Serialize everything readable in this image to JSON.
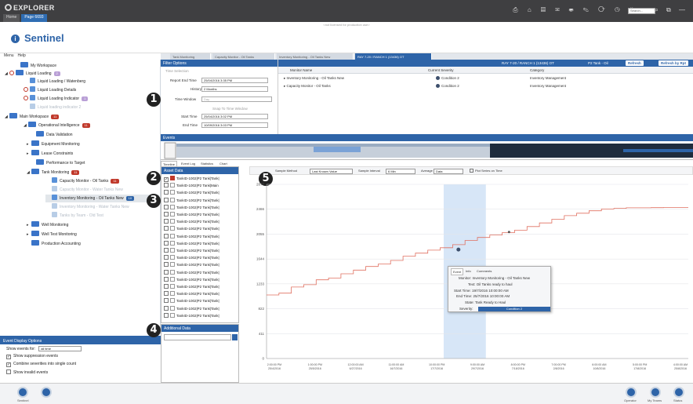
{
  "titlebar": {
    "app_title": "EXPLORER",
    "tabs": [
      "Home",
      "Page 6693"
    ],
    "search_placeholder": "Search..."
  },
  "header": {
    "app_name": "Sentinel",
    "message": "<not licensed for production use>"
  },
  "menu": {
    "items": [
      "Menu",
      "Help"
    ]
  },
  "tree": {
    "nodes": [
      {
        "label": "My Workspace"
      },
      {
        "label": "Liquid Loading",
        "badge": "2"
      },
      {
        "label": "Liquid Loading / Watenberg"
      },
      {
        "label": "Liquid Loading Details"
      },
      {
        "label": "Liquid Loading Indicator",
        "badge": "1"
      },
      {
        "label": "Liquid loading indicator 2"
      },
      {
        "label": "Main Workspace",
        "badge": "11"
      },
      {
        "label": "Operational Intelligence",
        "badge": "11"
      },
      {
        "label": "Data Validation"
      },
      {
        "label": "Equipment Monitoring"
      },
      {
        "label": "Lease Constraints"
      },
      {
        "label": "Performance to Target"
      },
      {
        "label": "Tank Monitoring",
        "badge": "11"
      },
      {
        "label": "Capacity Monitor - Oil Tanks",
        "badge": "11"
      },
      {
        "label": "Capacity Monitor - Water Tanks New"
      },
      {
        "label": "Inventory Monitoring - Oil Tanks New",
        "badge": "10"
      },
      {
        "label": "Inventory Monitoring - Water Tanks New"
      },
      {
        "label": "Tanks by Team - Old Test"
      },
      {
        "label": "Well Monitoring"
      },
      {
        "label": "Well Test Monitoring"
      },
      {
        "label": "Production Accounting"
      }
    ]
  },
  "event_display": {
    "title": "Event Display Options",
    "show_for_label": "Show events for:",
    "show_for_value": "all time",
    "opt1": "Show suppression events",
    "opt2": "Combine severities into single count",
    "opt3": "Show invalid events"
  },
  "footer": {
    "left_label": "Sentinel",
    "right_labels": [
      "Operator",
      "My Teams",
      "Status"
    ]
  },
  "doc_tabs": [
    "Tank Monitoring",
    "Capacity Monitor - Oil Tanks",
    "Inventory Monitoring - Oil Tanks New",
    "RAY 7-20 / RANCH 1 (13436) OT"
  ],
  "filter": {
    "title": "Filter Options",
    "time_selection": "Time Selection",
    "report_end_time_label": "Report End Time",
    "report_end_time": "25/04/2016 3:35 PM",
    "history_label": "History",
    "history": "2 Months",
    "time_window_label": "Time Window",
    "time_window": "Day",
    "snap_label": "Snap To Time Window",
    "start_time_label": "Start Time",
    "start_time": "25/04/2016 3:02 PM",
    "end_time_label": "End Time",
    "end_time": "10/09/2016 3:03 PM"
  },
  "toolbar": {
    "item1": "RAY 7-20 / RANCH 1 (13436) OT",
    "item2": "P2 Tank - Oil",
    "refresh": "Refresh",
    "refresh_by": "Refresh by Rpt"
  },
  "monitor_grid": {
    "columns": [
      "Monitor Name",
      "Current Severity",
      "Category"
    ],
    "rows": [
      {
        "name": "Inventory Monitoring - Oil Tanks New",
        "severity": "Condition 2",
        "category": "Inventory Management"
      },
      {
        "name": "Capacity Monitor - Oil Tanks",
        "severity": "Condition 2",
        "category": "Inventory Management"
      }
    ]
  },
  "events_title": "Events",
  "panel_tabs": [
    "Timeline",
    "Event Log",
    "Statistics",
    "Chart"
  ],
  "asset_list": {
    "title": "Asset Data",
    "rows": [
      "TankID-1002|P2 Tank|Tank|",
      "TankID-1002|P2 Tank|Main",
      "TankID-1002|P2 Tank|Tank|",
      "TankID-1002|P2 Tank|Tank|",
      "TankID-1002|P2 Tank|Tank|",
      "TankID-1002|P2 Tank|Tank|",
      "TankID-1002|P2 Tank|Tank|",
      "TankID-1002|P2 Tank|Tank|",
      "TankID-1002|P2 Tank|Tank|",
      "TankID-1002|P2 Tank|Tank|",
      "TankID-1002|P2 Tank|Tank|",
      "TankID-1002|P2 Tank|Tank|",
      "TankID-1002|P2 Tank|Tank|",
      "TankID-1002|P2 Tank|Tank|",
      "TankID-1002|P2 Tank|Tank|",
      "TankID-1002|P2 Tank|Tank|",
      "TankID-1002|P2 Tank|Tank|",
      "TankID-1002|P2 Tank|Tank|",
      "TankID-1002|P2 Tank|Tank|",
      "TankID-1002|P2 Tank|Tank|"
    ]
  },
  "additional": {
    "title": "Additional Data"
  },
  "chart_ctrl": {
    "sample_method_label": "Sample Method",
    "sample_method": "Last Known Value",
    "sample_interval_label": "Sample Interval",
    "sample_interval": "6 Min",
    "average_label": "Average",
    "average": "Data",
    "rolling_label": "Plot Series on Time"
  },
  "tooltip": {
    "tabs": [
      "Event",
      "Info",
      "Comments"
    ],
    "monitor_label": "Monitor:",
    "monitor": "Inventory Monitoring - Oil Tanks New",
    "text_label": "Text:",
    "text": "Oil Tanks ready to haul",
    "start_label": "Start Time:",
    "start": "19/7/2016 10:00:00 AM",
    "end_label": "End Time:",
    "end": "25/7/2016 10:00:00 AM",
    "state_label": "State:",
    "state": "Tank Ready to Haul",
    "severity_label": "Severity:",
    "severity": "Condition 2"
  },
  "callouts": [
    "1",
    "2",
    "3",
    "4",
    "5"
  ],
  "chart_data": {
    "type": "line",
    "title": "",
    "y_ticks": [
      "2877",
      "2466",
      "2055",
      "1644",
      "1233",
      "822",
      "411",
      "0"
    ],
    "x_ticks": [
      "2:00:00 PM\n25/4/2016",
      "1:00:00 PM\n25/5/2016",
      "12:00:00 AM\n6/27/2016",
      "11:00:00 AM\n16/7/2016",
      "10:00:00 PM\n17/7/2016",
      "9:00:00 AM\n29/7/2016",
      "8:00:00 PM\n7/18/2016",
      "7:00:00 PM\n2/8/2016",
      "6:00:00 AM\n10/8/2016",
      "5:00:00 PM\n17/8/2016",
      "4:00:00 AM\n25/8/2016"
    ],
    "ylim": [
      0,
      2877
    ],
    "series": [
      {
        "values": [
          1050,
          1080,
          1180,
          1220,
          1300,
          1330,
          1400,
          1460,
          1520,
          1560,
          1620,
          1690,
          1740,
          1790,
          1830,
          1880,
          1950,
          2000,
          2040,
          2080,
          2120,
          2180,
          2240,
          2300,
          2360,
          2400,
          2440,
          2470,
          2480,
          2490,
          2490,
          2492,
          2495,
          2495
        ]
      }
    ],
    "color": "#e07060",
    "highlight": {
      "start_frac": 0.42,
      "end_frac": 0.52,
      "color": "#d7e6f7"
    }
  }
}
